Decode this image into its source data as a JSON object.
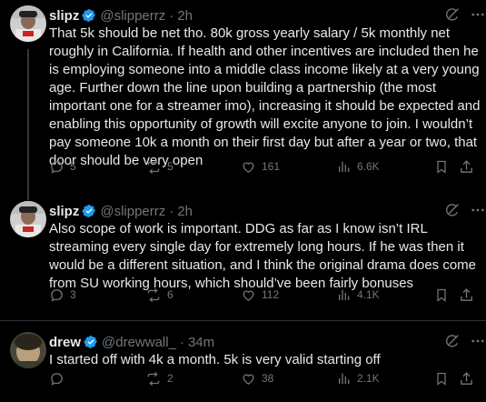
{
  "tweets": [
    {
      "name": "slipz",
      "handle": "@slipperrz",
      "time": "2h",
      "text": "That 5k should be net tho. 80k gross yearly salary / 5k monthly net roughly in California. If health and other incentives are included then he is employing someone into a middle class income likely at a very young age. Further down the line upon building a partnership (the most important one for a streamer imo), increasing it should be expected and enabling this opportunity of growth will excite anyone to join. I wouldn’t pay someone 10k a month on their first day but after a year or two, that door should be very open",
      "replies": "5",
      "reposts": "5",
      "likes": "161",
      "views": "6.6K"
    },
    {
      "name": "slipz",
      "handle": "@slipperrz",
      "time": "2h",
      "text": "Also scope of work is important. DDG as far as I know isn’t IRL streaming every single day for extremely long hours. If he was then it would be a different situation, and I think the original drama does come from SU working hours, which should’ve been fairly bonuses",
      "replies": "3",
      "reposts": "6",
      "likes": "112",
      "views": "4.1K"
    },
    {
      "name": "drew",
      "handle": "@drewwall_",
      "time": "34m",
      "text": "I started off with 4k a month. 5k is very valid starting off",
      "replies": "",
      "reposts": "2",
      "likes": "38",
      "views": "2.1K"
    }
  ],
  "colors": {
    "verified": "#1d9bf0",
    "muted": "#71767b",
    "text": "#e7e9ea",
    "background": "#000000"
  }
}
